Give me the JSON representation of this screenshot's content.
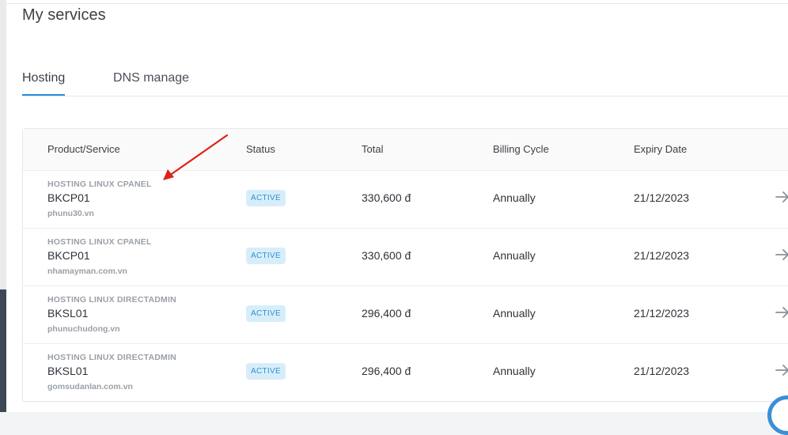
{
  "page": {
    "title": "My services"
  },
  "tabs": [
    {
      "label": "Hosting",
      "active": true
    },
    {
      "label": "DNS manage",
      "active": false
    }
  ],
  "table": {
    "headers": [
      "Product/Service",
      "Status",
      "Total",
      "Billing Cycle",
      "Expiry Date"
    ],
    "rows": [
      {
        "category": "HOSTING LINUX CPANEL",
        "code": "BKCP01",
        "domain": "phunu30.vn",
        "status": "ACTIVE",
        "total": "330,600 đ",
        "cycle": "Annually",
        "expiry": "21/12/2023"
      },
      {
        "category": "HOSTING LINUX CPANEL",
        "code": "BKCP01",
        "domain": "nhamayman.com.vn",
        "status": "ACTIVE",
        "total": "330,600 đ",
        "cycle": "Annually",
        "expiry": "21/12/2023"
      },
      {
        "category": "HOSTING LINUX DIRECTADMIN",
        "code": "BKSL01",
        "domain": "phunuchudong.vn",
        "status": "ACTIVE",
        "total": "296,400 đ",
        "cycle": "Annually",
        "expiry": "21/12/2023"
      },
      {
        "category": "HOSTING LINUX DIRECTADMIN",
        "code": "BKSL01",
        "domain": "gomsudanlan.com.vn",
        "status": "ACTIVE",
        "total": "296,400 đ",
        "cycle": "Annually",
        "expiry": "21/12/2023"
      }
    ]
  },
  "colors": {
    "accent": "#2b8fd6",
    "badge_bg": "#d7eefa",
    "badge_text": "#3191cf",
    "annotation": "#e0201b"
  },
  "icons": {
    "row_action": "arrow-right-icon",
    "annotation": "red-arrow-annotation"
  }
}
